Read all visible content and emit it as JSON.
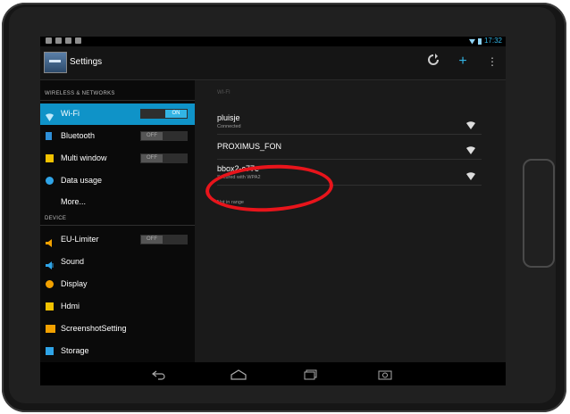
{
  "status_bar": {
    "clock": "17:32"
  },
  "action_bar": {
    "title": "Settings",
    "icons": [
      "settings-app-icon",
      "refresh-icon",
      "add-icon",
      "overflow-menu-icon"
    ]
  },
  "sections": {
    "wireless": "WIRELESS & NETWORKS",
    "device": "DEVICE"
  },
  "menu": [
    {
      "label": "Wi-Fi",
      "icon": "wifi-icon",
      "toggle": "ON",
      "selected": true
    },
    {
      "label": "Bluetooth",
      "icon": "bluetooth-icon",
      "toggle": "OFF"
    },
    {
      "label": "Multi window",
      "icon": "multi-window-icon",
      "toggle": "OFF"
    },
    {
      "label": "Data usage",
      "icon": "data-usage-icon"
    },
    {
      "label": "More...",
      "icon": ""
    },
    {
      "label": "EU-Limiter",
      "icon": "eu-limiter-icon",
      "toggle": "OFF"
    },
    {
      "label": "Sound",
      "icon": "sound-icon"
    },
    {
      "label": "Display",
      "icon": "display-icon"
    },
    {
      "label": "Hdmi",
      "icon": "hdmi-icon"
    },
    {
      "label": "ScreenshotSetting",
      "icon": "screenshot-icon"
    },
    {
      "label": "Storage",
      "icon": "storage-icon"
    }
  ],
  "wifi_panel": {
    "header": "WI-FI",
    "networks": [
      {
        "name": "pluisje",
        "status": "Connected"
      },
      {
        "name": "PROXIMUS_FON",
        "status": ""
      },
      {
        "name": "bbox2-c77e",
        "status": "Secured with WPA2"
      },
      {
        "name": "",
        "status": "Not in range"
      }
    ]
  },
  "colors": {
    "accent": "#33b5e5",
    "selected": "#0f93c8",
    "highlight": "#e8141b"
  }
}
